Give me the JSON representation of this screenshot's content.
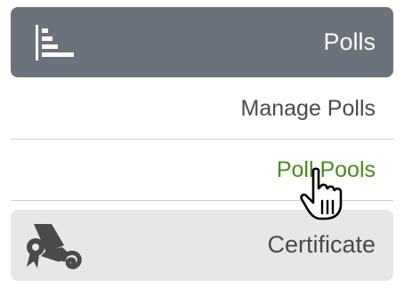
{
  "header": {
    "label": "Polls",
    "icon": "bar-chart-icon"
  },
  "items": [
    {
      "label": "Manage Polls"
    },
    {
      "label": "Poll Pools",
      "state": "hover"
    }
  ],
  "certificate": {
    "label": "Certificate",
    "icon": "diploma-scroll-icon"
  },
  "cursor": {
    "icon": "hand-pointer-icon"
  },
  "colors": {
    "header_bg": "#6b727b",
    "header_text": "#ffffff",
    "item_text": "#4a4a4a",
    "hover_text": "#4a8a1e",
    "cert_bg": "#e6e7e8",
    "divider": "#cfcfcf"
  }
}
